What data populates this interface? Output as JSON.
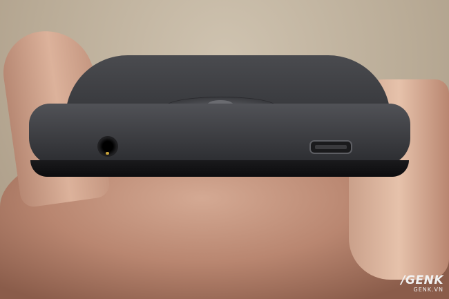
{
  "watermark": {
    "logo": "/GENK",
    "url": "GENK.VN"
  },
  "colors": {
    "background": "#b9ab96",
    "phone": "#3c3d41",
    "skin": "#c9987f",
    "watermark": "#f2f2f2"
  }
}
